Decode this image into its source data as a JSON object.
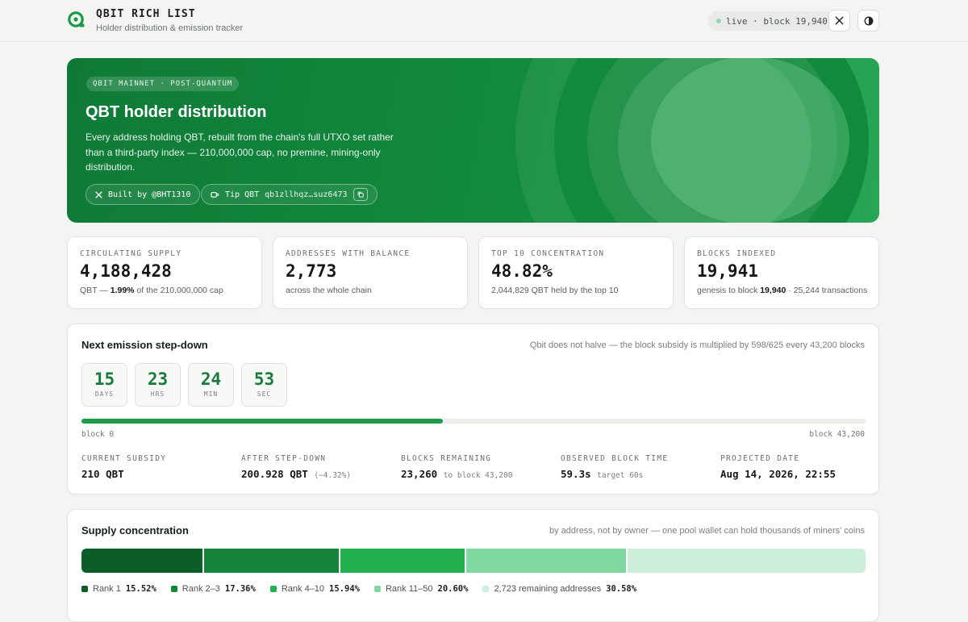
{
  "header": {
    "brand": "QBIT RICH LIST",
    "subtitle": "Holder distribution & emission tracker",
    "live_status": "live · block 19,940",
    "x_icon": "x-logo-icon",
    "theme_icon": "theme-toggle-icon"
  },
  "hero": {
    "tag": "QBIT MAINNET · POST-QUANTUM",
    "title": "QBT holder distribution",
    "description": "Every address holding QBT, rebuilt from the chain's full UTXO set rather than a third-party index — 210,000,000 cap, no premine, mining-only distribution.",
    "built_by": "Built by @BHT1310",
    "tip_label": "Tip QBT",
    "tip_address": "qb1zllhqz…suz6473",
    "colors": {
      "hero": "#128a3d",
      "accent": "#1f9a48"
    }
  },
  "stats": [
    {
      "label": "CIRCULATING SUPPLY",
      "value": "4,188,428",
      "sub_pre": "QBT — ",
      "sub_bold": "1.99%",
      "sub_post": " of the 210,000,000 cap"
    },
    {
      "label": "ADDRESSES WITH BALANCE",
      "value": "2,773",
      "sub_pre": "across the whole chain",
      "sub_bold": "",
      "sub_post": ""
    },
    {
      "label": "TOP 10 CONCENTRATION",
      "value": "48.82%",
      "sub_pre": "2,044,829 QBT held by the top 10",
      "sub_bold": "",
      "sub_post": ""
    },
    {
      "label": "BLOCKS INDEXED",
      "value": "19,941",
      "sub_pre": "genesis to block ",
      "sub_bold": "19,940",
      "sub_post": " · 25,244 transactions"
    }
  ],
  "emission": {
    "title": "Next emission step-down",
    "note": "Qbit does not halve — the block subsidy is multiplied by 598/625 every 43,200 blocks",
    "countdown": [
      {
        "num": "15",
        "unit": "DAYS"
      },
      {
        "num": "23",
        "unit": "HRS"
      },
      {
        "num": "24",
        "unit": "MIN"
      },
      {
        "num": "53",
        "unit": "SEC"
      }
    ],
    "progress_fraction": 0.4614,
    "progress_start": "block 0",
    "progress_end": "block 43,200",
    "details": [
      {
        "label": "CURRENT SUBSIDY",
        "value": "210 QBT",
        "extra": ""
      },
      {
        "label": "AFTER STEP-DOWN",
        "value": "200.928 QBT",
        "extra": "(−4.32%)"
      },
      {
        "label": "BLOCKS REMAINING",
        "value": "23,260",
        "extra": "to block 43,200"
      },
      {
        "label": "OBSERVED BLOCK TIME",
        "value": "59.3s",
        "extra": "target 60s"
      },
      {
        "label": "PROJECTED DATE",
        "value": "Aug 14, 2026, 22:55",
        "extra": ""
      }
    ]
  },
  "concentration": {
    "title": "Supply concentration",
    "note": "by address, not by owner — one pool wallet can hold thousands of miners' coins",
    "segments": [
      {
        "label": "Rank 1",
        "pct": "15.52%",
        "value": 15.52,
        "color": "#0b5e27"
      },
      {
        "label": "Rank 2–3",
        "pct": "17.36%",
        "value": 17.36,
        "color": "#148439"
      },
      {
        "label": "Rank 4–10",
        "pct": "15.94%",
        "value": 15.94,
        "color": "#22b04f"
      },
      {
        "label": "Rank 11–50",
        "pct": "20.60%",
        "value": 20.6,
        "color": "#7fd9a0"
      },
      {
        "label": "2,723 remaining addresses",
        "pct": "30.58%",
        "value": 30.58,
        "color": "#cdeed8"
      }
    ]
  }
}
